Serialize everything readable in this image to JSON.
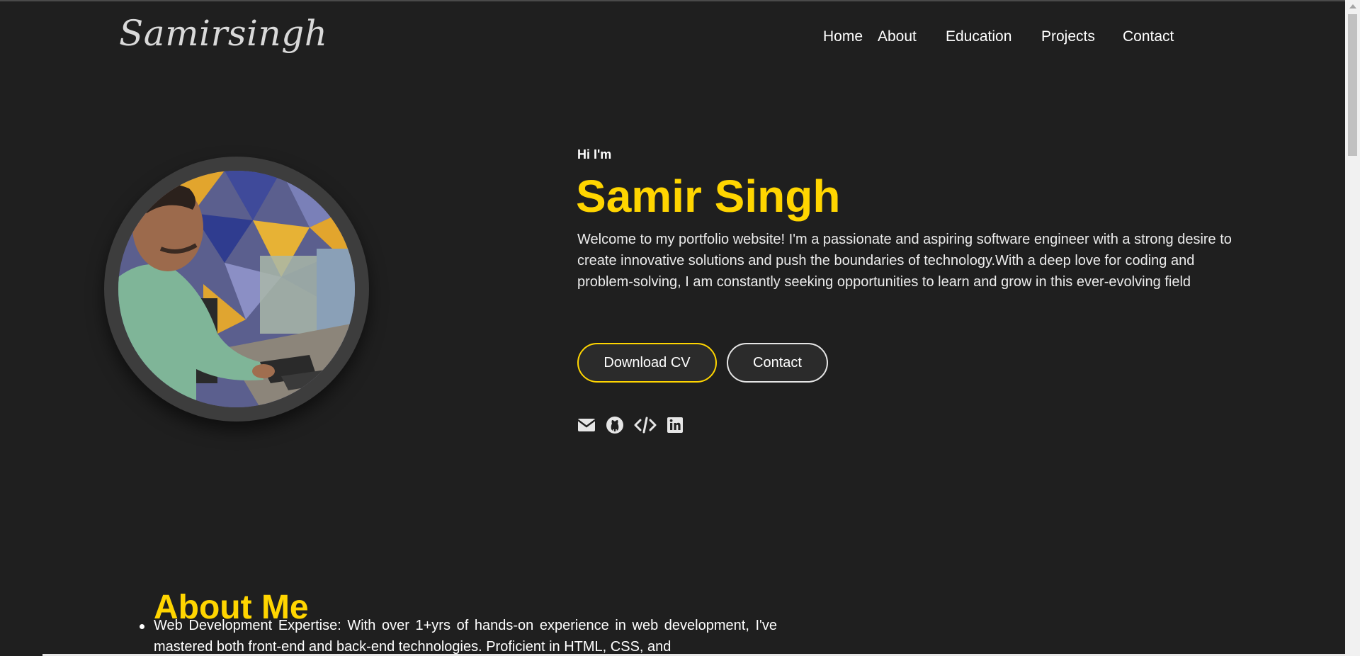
{
  "nav": {
    "logo": "Samirsingh",
    "items": [
      {
        "label": "Home"
      },
      {
        "label": "About"
      },
      {
        "label": "Education"
      },
      {
        "label": "Projects"
      },
      {
        "label": "Contact"
      }
    ]
  },
  "hero": {
    "greeting": "Hi I'm",
    "name": "Samir Singh",
    "intro": "Welcome to my portfolio website! I'm a passionate and aspiring software engineer with a strong desire to create innovative solutions and push the boundaries of technology.With a deep love for coding and problem-solving, I am constantly seeking opportunities to learn and grow in this ever-evolving field",
    "buttons": {
      "download_cv": "Download CV",
      "contact": "Contact"
    },
    "socials": [
      "envelope-icon",
      "github-icon",
      "code-icon",
      "linkedin-icon"
    ],
    "accent_color": "#ffd500"
  },
  "about": {
    "title": "About Me",
    "items": [
      "Web Development Expertise: With over 1+yrs of hands-on experience in web development, I've mastered both front-end and back-end technologies. Proficient in HTML, CSS, and"
    ]
  }
}
